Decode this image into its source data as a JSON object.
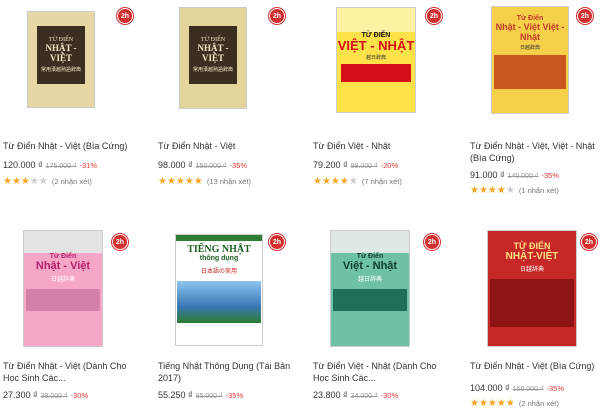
{
  "badge_label": "2h",
  "products": [
    {
      "cover": {
        "top": "TỪ ĐIỂN",
        "main": "NHẬT - VIỆT",
        "sub": "常用漢越熟語辞典",
        "bg": "#e7d7a4",
        "panel": "#3b2e20"
      },
      "title": "Từ Điển Nhật - Việt (Bìa Cứng)",
      "price": "120.000 ₫",
      "old_price": "175.000 ₫",
      "discount": "-31%",
      "rating": 3,
      "reviews": "(2 nhận xét)"
    },
    {
      "cover": {
        "top": "TỪ ĐIỂN",
        "main": "NHẬT - VIỆT",
        "sub": "常用漢越熟語辞典",
        "bg": "#e3d49c",
        "panel": "#3b2e20"
      },
      "title": "Từ Điển Nhật - Việt",
      "price": "98.000 ₫",
      "old_price": "150.000 ₫",
      "discount": "-35%",
      "rating": 5,
      "reviews": "(13 nhận xét)"
    },
    {
      "cover": {
        "top": "TỪ ĐIỂN",
        "main": "VIỆT - NHẬT",
        "sub": "越日辞典",
        "bg": "#fde24a",
        "panel": "#d40f19"
      },
      "title": "Từ Điển Việt - Nhật",
      "price": "79.200 ₫",
      "old_price": "99.000 ₫",
      "discount": "-20%",
      "rating": 4,
      "reviews": "(7 nhận xét)"
    },
    {
      "cover": {
        "top": "Từ Điển",
        "main": "Nhật - Việt Việt - Nhật",
        "sub": "日越辞典",
        "bg": "#f7d04a",
        "panel": "#c9581f"
      },
      "title": "Từ Điển Nhật - Việt, Việt - Nhật (Bìa Cứng)",
      "price": "91.000 ₫",
      "old_price": "140.000 ₫",
      "discount": "-35%",
      "rating": 4,
      "reviews": "(1 nhận xét)"
    },
    {
      "cover": {
        "top": "Từ Điển",
        "main": "Nhật - Việt",
        "sub": "日越辞典",
        "bg": "#f6a7c8",
        "panel": "#b3206a"
      },
      "title": "Từ Điển Nhật - Việt (Dành Cho Học Sinh Các...",
      "price": "27.300 ₫",
      "old_price": "39.000 ₫",
      "discount": "-30%",
      "rating": 0,
      "reviews": ""
    },
    {
      "cover": {
        "top": "TIẾNG NHẬT",
        "main": "thông dụng",
        "sub": "日本語の実用",
        "bg": "#ffffff",
        "panel": "#2e7d32"
      },
      "title": "Tiếng Nhật Thông Dụng (Tái Bản 2017)",
      "price": "55.250 ₫",
      "old_price": "85.000 ₫",
      "discount": "-35%",
      "rating": 0,
      "reviews": ""
    },
    {
      "cover": {
        "top": "Từ Điển",
        "main": "Việt - Nhật",
        "sub": "越日辞典",
        "bg": "#6fc1a6",
        "panel": "#1f6f5a"
      },
      "title": "Từ Điển Việt - Nhật (Dành Cho Học Sinh Các...",
      "price": "23.800 ₫",
      "old_price": "34.000 ₫",
      "discount": "-30%",
      "rating": 0,
      "reviews": ""
    },
    {
      "cover": {
        "top": "TỪ ĐIỂN",
        "main": "NHẬT-VIỆT",
        "sub": "日越辞典",
        "bg": "#c62828",
        "panel": "#8e1414"
      },
      "title": "Từ Điển Nhật - Việt (Bìa Cứng)",
      "price": "104.000 ₫",
      "old_price": "160.000 ₫",
      "discount": "-35%",
      "rating": 5,
      "reviews": "(2 nhận xét)"
    }
  ]
}
